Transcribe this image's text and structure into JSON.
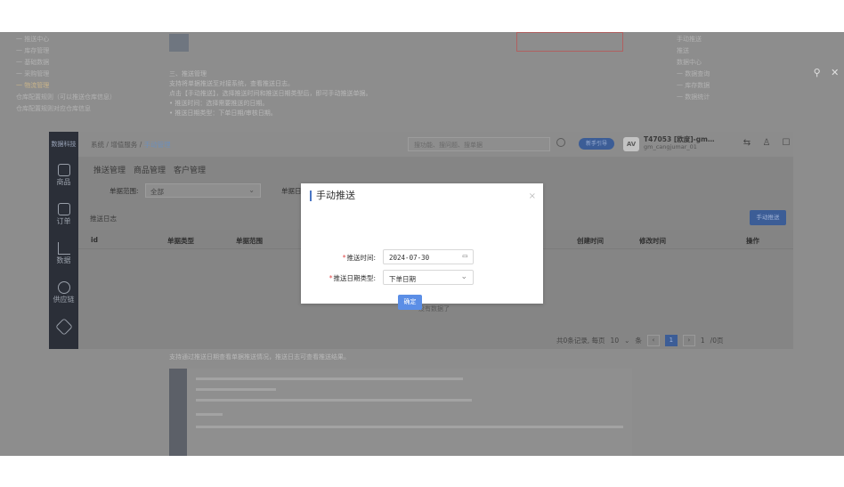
{
  "viewer": {
    "zoom_icon": "search-icon",
    "close_icon": "close-icon"
  },
  "doc": {
    "sidebar": [
      "一 推送中心",
      "一 库存管理",
      "一 基础数据",
      "一 采购管理",
      "一 物流管理",
      "仓库配置规则（可以推送仓库信息）",
      "仓库配置规则对应仓库信息"
    ],
    "section_title": "三、推送管理",
    "lines": [
      "支持将单据推送至对接系统，查看推送日志。",
      "点击【手动推送】，选择推送时间和推送日期类型后，即可手动推送单据。",
      "• 推送时间：选择需要推送的日期。",
      "• 推送日期类型：下单日期/审核日期。"
    ],
    "right_menu": [
      "手动推送",
      "推送",
      "数据中心",
      "一 数据查询",
      "一 库存数据",
      "一 数据统计"
    ],
    "below_text": "支持通过推送日期查看单据推送情况，推送日志可查看推送结果。"
  },
  "app": {
    "logo": "数据科技",
    "sidebar": [
      {
        "label": "商品",
        "icon": "box-icon"
      },
      {
        "label": "订单",
        "icon": "order-icon"
      },
      {
        "label": "数据",
        "icon": "chart-icon"
      },
      {
        "label": "供应链",
        "icon": "link-icon"
      },
      {
        "label": "",
        "icon": "cube-icon"
      }
    ],
    "breadcrumb": {
      "a": "系统",
      "sep1": "/",
      "b": "增值服务",
      "sep2": "/",
      "c": "手动管理"
    },
    "search_placeholder": "搜功能、搜问题、搜单据",
    "pill": "新手引导",
    "avatar": "AV",
    "user_name": "T47053 [欧度]-gm…",
    "user_sub": "gm_cangjumar_01",
    "top_icons": [
      "⇆",
      "♙",
      "☐",
      "?",
      "⋮"
    ],
    "tabs": [
      "推送管理",
      "商品管理",
      "客户管理"
    ],
    "filter1_label": "单据范围:",
    "filter1_value": "全部",
    "filter2_label": "单据日",
    "log_label": "推送日志",
    "push_button": "手动推送",
    "columns": [
      "id",
      "单据类型",
      "单据范围",
      "创建时间",
      "修改时间",
      "操作"
    ],
    "empty": "没有数据了",
    "pager": {
      "total": "共0条记录, 每页",
      "size": "10",
      "unit": "条",
      "prev": "‹",
      "page": "1",
      "next": "›",
      "goto": "1",
      "pages": "/0页"
    }
  },
  "dialog": {
    "title": "手动推送",
    "close": "×",
    "date_label": "推送时间:",
    "date_value": "2024-07-30",
    "type_label": "推送日期类型:",
    "type_value": "下单日期",
    "ok": "确定"
  }
}
